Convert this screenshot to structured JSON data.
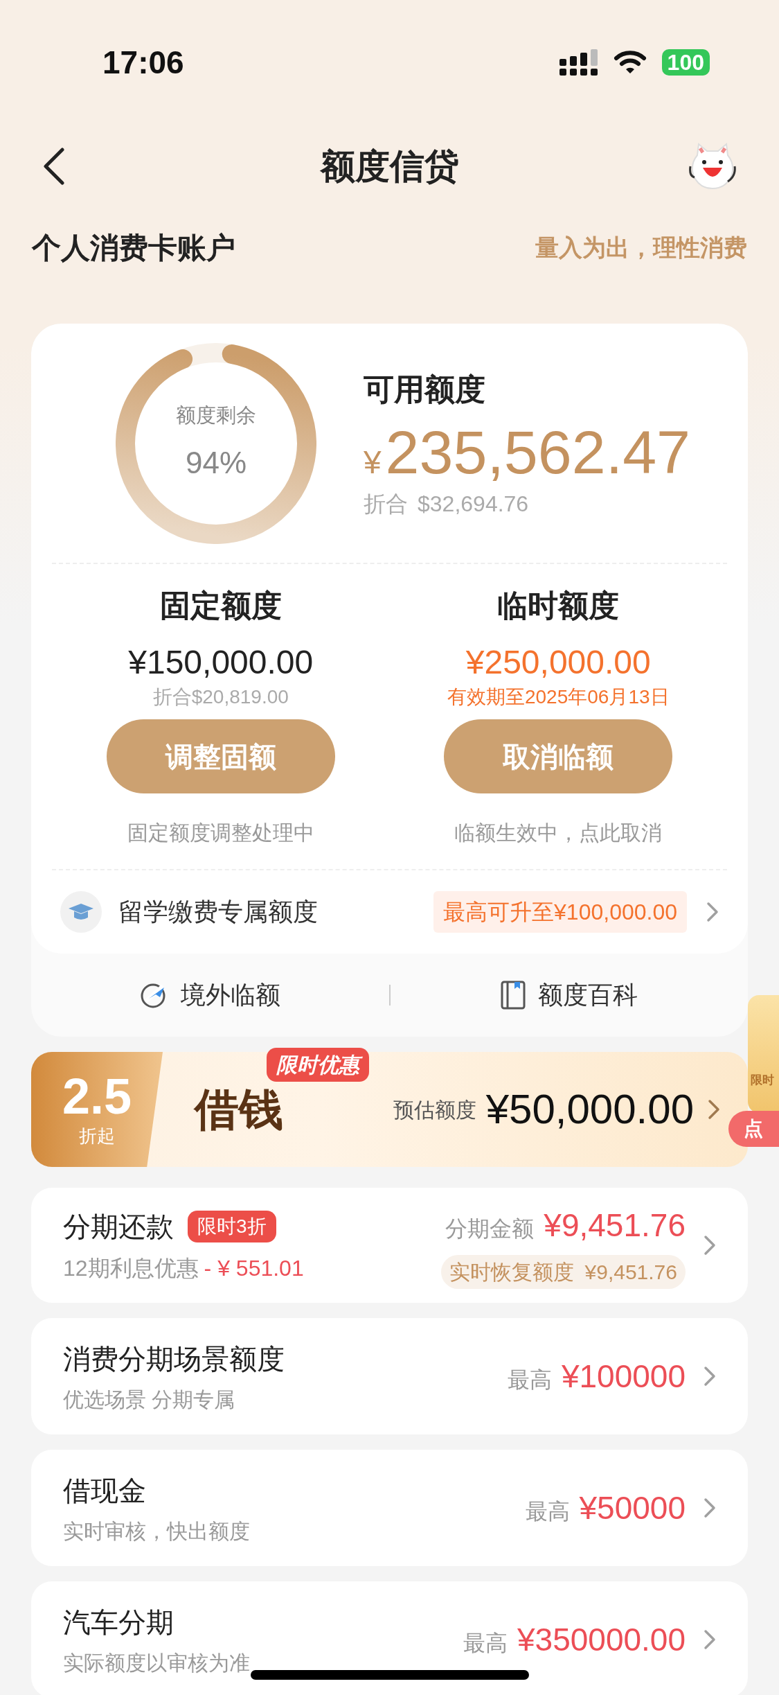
{
  "status_bar": {
    "time": "17:06",
    "battery": "100"
  },
  "nav": {
    "title": "额度信贷"
  },
  "account": {
    "title": "个人消费卡账户",
    "slogan": "量入为出，理性消费"
  },
  "credit_card": {
    "ring": {
      "label": "额度剩余",
      "percent": "94%",
      "level": 0.94
    },
    "available": {
      "label": "可用额度",
      "currency": "¥",
      "amount": "235,562.47",
      "converted_label": "折合",
      "converted_amount": "$32,694.76"
    },
    "limits": [
      {
        "title": "固定额度",
        "amount": "¥150,000.00",
        "kind": "fixed",
        "detail": "折合$20,819.00",
        "button": "调整固额",
        "note": "固定额度调整处理中"
      },
      {
        "title": "临时额度",
        "amount": "¥250,000.00",
        "kind": "temporary",
        "detail": "有效期至2025年06月13日",
        "button": "取消临额",
        "note": "临额生效中，点此取消"
      }
    ],
    "study": {
      "label": "留学缴费专属额度",
      "badge": "最高可升至¥100,000.00"
    },
    "footer": [
      {
        "label": "境外临额",
        "kind": "plane"
      },
      {
        "label": "额度百科",
        "kind": "book"
      }
    ]
  },
  "loan_banner": {
    "discount": "2.5",
    "discount_unit": "折起",
    "title": "借钱",
    "tag": "限时优惠",
    "estimate_label": "预估额度",
    "amount": "¥50,000.00"
  },
  "installment": {
    "title": "分期还款",
    "tag": "限时3折",
    "subtitle": "12期利息优惠",
    "saving": "- ¥ 551.01",
    "amount_label": "分期金额",
    "amount": "¥9,451.76",
    "restore_label": "实时恢复额度",
    "restore_amount": "¥9,451.76"
  },
  "products": [
    {
      "title": "消费分期场景额度",
      "subtitle": "优选场景 分期专属",
      "max_label": "最高",
      "amount": "¥100000"
    },
    {
      "title": "借现金",
      "subtitle": "实时审核，快出额度",
      "max_label": "最高",
      "amount": "¥50000"
    },
    {
      "title": "汽车分期",
      "subtitle": "实际额度以审核为准",
      "max_label": "最高",
      "amount": "¥350000.00"
    }
  ],
  "float_widget": {
    "top_text": "限时",
    "button_text": "点"
  }
}
